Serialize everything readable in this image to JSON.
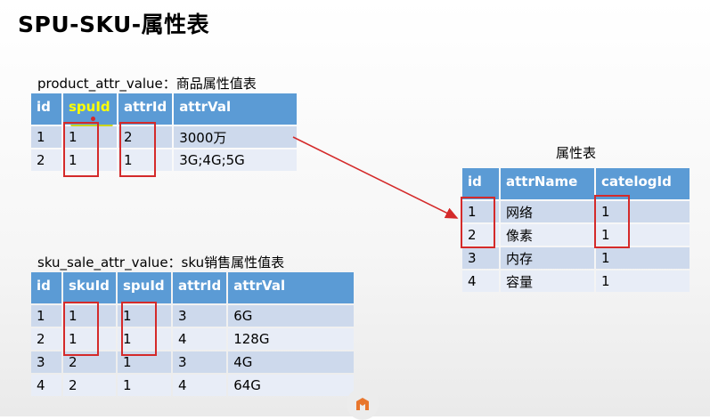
{
  "title": "SPU-SKU-属性表",
  "product_attr_value": {
    "caption": "product_attr_value：商品属性值表",
    "headers": [
      "id",
      "spuId",
      "attrId",
      "attrVal"
    ],
    "rows": [
      [
        "1",
        "1",
        "2",
        "3000万"
      ],
      [
        "2",
        "1",
        "1",
        "3G;4G;5G"
      ]
    ]
  },
  "attr": {
    "caption": "属性表",
    "headers": [
      "id",
      "attrName",
      "catelogId"
    ],
    "rows": [
      [
        "1",
        "网络",
        "1"
      ],
      [
        "2",
        "像素",
        "1"
      ],
      [
        "3",
        "内存",
        "1"
      ],
      [
        "4",
        "容量",
        "1"
      ]
    ]
  },
  "sku_sale_attr_value": {
    "caption": "sku_sale_attr_value：sku销售属性值表",
    "headers": [
      "id",
      "skuId",
      "spuId",
      "attrId",
      "attrVal"
    ],
    "rows": [
      [
        "1",
        "1",
        "1",
        "3",
        "6G"
      ],
      [
        "2",
        "1",
        "1",
        "4",
        "128G"
      ],
      [
        "3",
        "2",
        "1",
        "3",
        "4G"
      ],
      [
        "4",
        "2",
        "1",
        "4",
        "64G"
      ]
    ]
  },
  "colors": {
    "header": "#5b9bd5",
    "row_dark": "#cdd9ec",
    "row_light": "#e8edf7",
    "annotation": "#d42a2a",
    "highlight": "#c8d200"
  },
  "icons": [
    "watermark-logo-icon"
  ]
}
